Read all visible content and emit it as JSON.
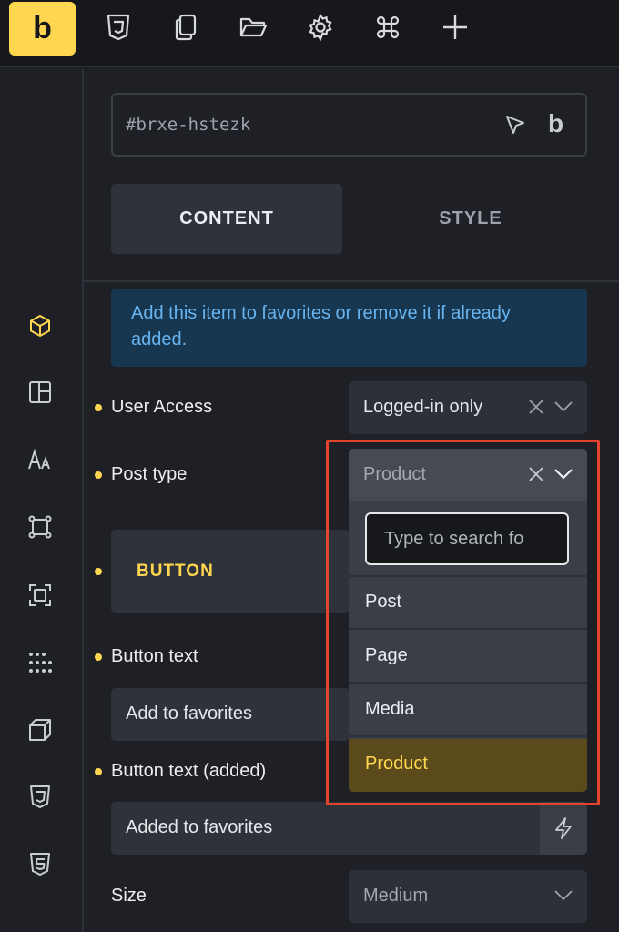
{
  "toolbar": {
    "logo": "b",
    "icons": [
      "css3-icon",
      "pages-icon",
      "folder-icon",
      "gear-icon",
      "command-icon",
      "plus-icon"
    ]
  },
  "rail": {
    "icons": [
      "cube-icon",
      "layout-icon",
      "typography-icon",
      "frame-icon",
      "focus-icon",
      "grid-dots-icon",
      "box-3d-icon",
      "css3-icon",
      "html5-icon"
    ]
  },
  "element": {
    "id": "#brxe-hstezk",
    "b_label": "b"
  },
  "tabs": {
    "content": "CONTENT",
    "style": "STYLE"
  },
  "info": "Add this item to favorites or remove it if already added.",
  "fields": {
    "user_access": {
      "label": "User Access",
      "value": "Logged-in only"
    },
    "post_type": {
      "label": "Post type",
      "value": "Product"
    },
    "button_group": "BUTTON",
    "button_text": {
      "label": "Button text",
      "value": "Add to favorites"
    },
    "button_text_added": {
      "label": "Button text (added)",
      "value": "Added to favorites"
    },
    "size": {
      "label": "Size",
      "value": "Medium"
    }
  },
  "dropdown": {
    "search_placeholder": "Type to search fo",
    "options": [
      "Post",
      "Page",
      "Media",
      "Product"
    ],
    "selected": "Product"
  },
  "colors": {
    "accent": "#ffd64f",
    "info_bg": "#173650",
    "info_text": "#67b4f0",
    "highlight": "#e4432e",
    "selected_bg": "#5b4a1c"
  }
}
